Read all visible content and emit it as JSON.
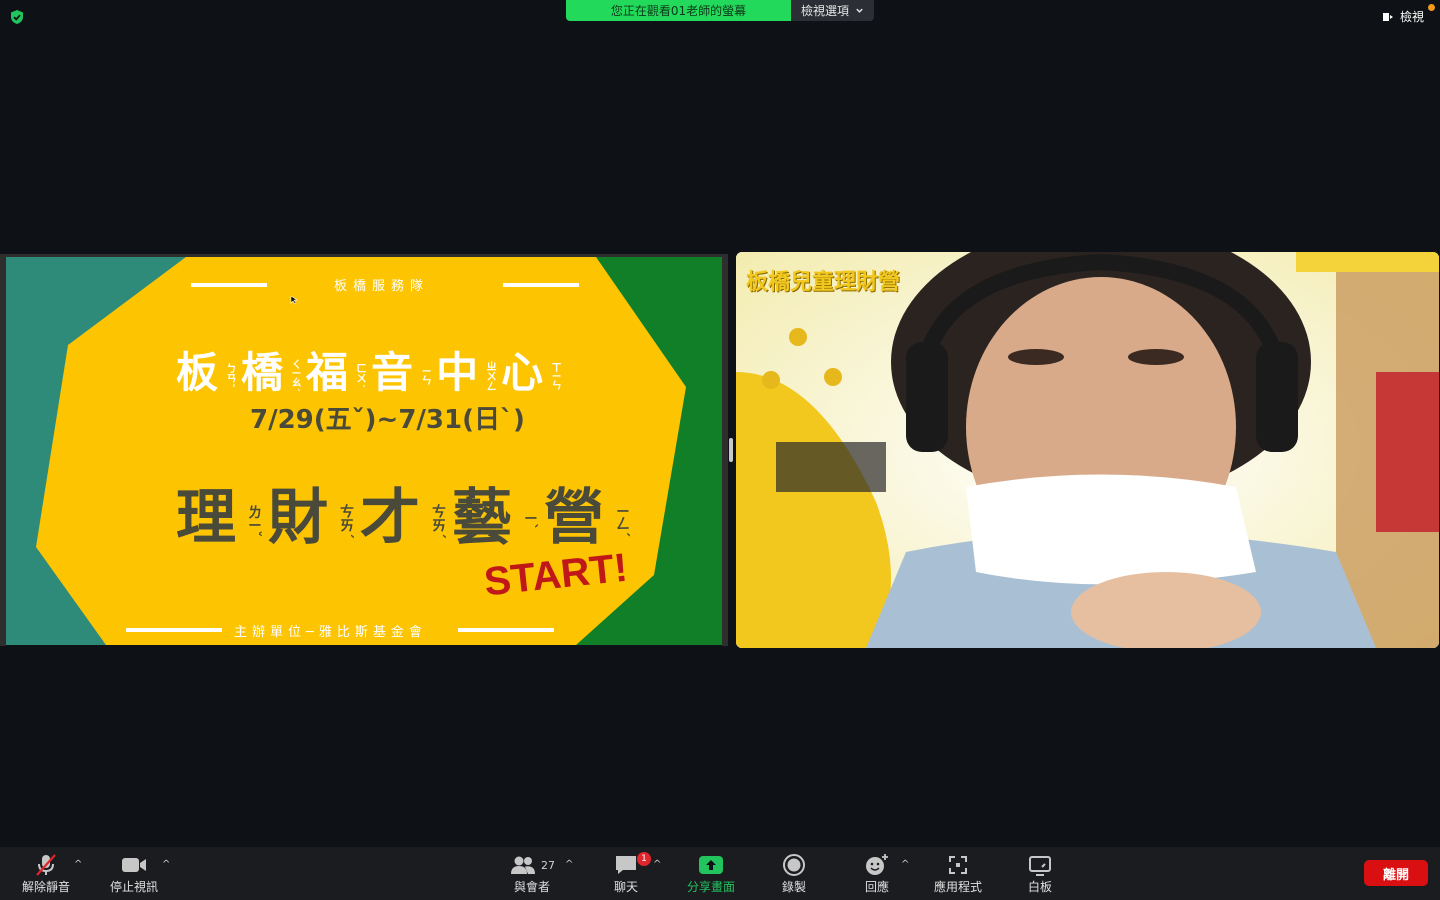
{
  "topbar": {
    "share_notice": "您正在觀看01老師的螢幕",
    "view_options_label": "檢視選項",
    "view_label": "檢視"
  },
  "slide": {
    "team": "板橋服務隊",
    "center_title": "板橋福音中心",
    "center_zhuyin": [
      "ㄅㄢˇ",
      "ㄑㄧㄠˊ",
      "ㄈㄨˊ",
      "ㄧㄣ",
      "ㄓㄨㄥ",
      "ㄒㄧㄣ"
    ],
    "dates": "7/29(五ˇ)~7/31(日ˋ)",
    "camp_title": "理財才藝營",
    "camp_zhuyin": [
      "ㄌㄧˇ",
      "ㄘㄞˊ",
      "ㄘㄞˊ",
      "ㄧˋ",
      "ㄧㄥˊ"
    ],
    "start": "START!",
    "organizer": "主辦單位─雅比斯基金會",
    "colors": {
      "yellow": "#fdc402",
      "teal": "#2e8b7a",
      "green": "#117f27",
      "text": "#4a4a3a",
      "start_red": "#c01818"
    }
  },
  "video": {
    "overlay_title": "板橋兒童理財營"
  },
  "toolbar": {
    "unmute": "解除靜音",
    "stop_video": "停止視訊",
    "participants": "與會者",
    "participants_count": "27",
    "chat": "聊天",
    "chat_badge": "1",
    "share_screen": "分享畫面",
    "record": "錄製",
    "reactions": "回應",
    "apps": "應用程式",
    "whiteboard": "白板",
    "leave": "離開"
  }
}
